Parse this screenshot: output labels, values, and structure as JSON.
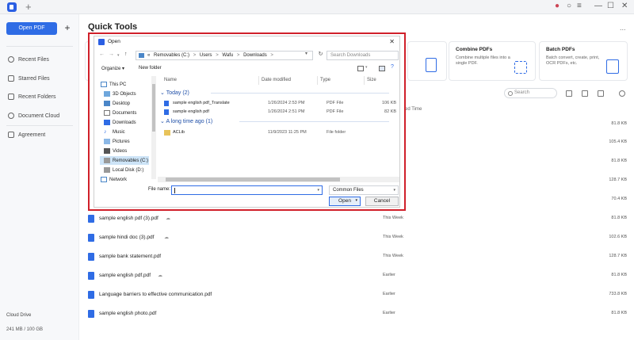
{
  "colors": {
    "accent": "#2f6ce5",
    "dialog_border": "#d0202a"
  },
  "sidebar": {
    "open_pdf": "Open PDF",
    "add": "+",
    "items": [
      {
        "label": "Recent Files",
        "icon": "clock-icon"
      },
      {
        "label": "Starred Files",
        "icon": "star-icon"
      },
      {
        "label": "Recent Folders",
        "icon": "folder-icon"
      },
      {
        "label": "Document Cloud",
        "icon": "cloud-icon"
      },
      {
        "label": "Agreement",
        "icon": "agreement-icon"
      }
    ],
    "cloud_drive": "Cloud Drive",
    "storage": "241 MB / 100 GB"
  },
  "main": {
    "quick_tools_title": "Quick Tools",
    "more": "...",
    "tools": [
      {
        "title": "Combine PDFs",
        "desc": "Combine multiple files into a single PDF."
      },
      {
        "title": "Batch PDFs",
        "desc": "Batch convert, create, print, OCR PDFs, etc."
      }
    ],
    "recent_head": "R",
    "search_placeholder": "Search",
    "col_name": "N",
    "col_time": "ed Time",
    "rows": [
      {
        "name": "",
        "time": "",
        "size": "81.8 KB"
      },
      {
        "name": "",
        "time": "",
        "size": "105.4 KB"
      },
      {
        "name": "",
        "time": "",
        "size": "81.8 KB"
      },
      {
        "name": "",
        "time": "",
        "size": "128.7 KB"
      },
      {
        "name": "",
        "time": "",
        "size": "70.4 KB"
      },
      {
        "name": "sample english pdf (3).pdf",
        "time": "This Week",
        "size": "81.8 KB"
      },
      {
        "name": "sample hindi doc (3).pdf",
        "time": "This Week",
        "size": "102.6 KB"
      },
      {
        "name": "sample bank statement.pdf",
        "time": "This Week",
        "size": "128.7 KB"
      },
      {
        "name": "sample english pdf.pdf",
        "time": "Earlier",
        "size": "81.8 KB"
      },
      {
        "name": "Language barriers to effective communication.pdf",
        "time": "Earlier",
        "size": "733.8 KB"
      },
      {
        "name": "sample english photo.pdf",
        "time": "Earlier",
        "size": "81.8 KB"
      }
    ]
  },
  "dialog": {
    "title": "Open",
    "close": "✕",
    "path": [
      "Removables (C:)",
      ">",
      "Users",
      ">",
      "Wafu",
      ">",
      "Downloads",
      ">"
    ],
    "path_prefix": "«",
    "search_placeholder": "Search Downloads",
    "organize": "Organize ▾",
    "new_folder": "New folder",
    "nav_items": [
      {
        "label": "This PC",
        "icon": "pc-icon"
      },
      {
        "label": "3D Objects",
        "icon": "cube-icon"
      },
      {
        "label": "Desktop",
        "icon": "desktop-icon"
      },
      {
        "label": "Documents",
        "icon": "documents-icon"
      },
      {
        "label": "Downloads",
        "icon": "download-icon"
      },
      {
        "label": "Music",
        "icon": "music-icon"
      },
      {
        "label": "Pictures",
        "icon": "pictures-icon"
      },
      {
        "label": "Videos",
        "icon": "videos-icon"
      },
      {
        "label": "Removables (C:)",
        "icon": "drive-icon"
      },
      {
        "label": "Local Disk (D:)",
        "icon": "drive-icon"
      },
      {
        "label": "Network",
        "icon": "network-icon"
      }
    ],
    "columns": {
      "name": "Name",
      "date": "Date modified",
      "type": "Type",
      "size": "Size"
    },
    "groups": [
      {
        "label": "Today (2)"
      },
      {
        "label": "A long time ago (1)"
      }
    ],
    "files": [
      {
        "name": "sample english pdf_Translate",
        "date": "1/26/2024 2:53 PM",
        "type": "PDF File",
        "size": "106 KB"
      },
      {
        "name": "sample english pdf",
        "date": "1/26/2024 2:51 PM",
        "type": "PDF File",
        "size": "82 KB"
      },
      {
        "name": "ACLib",
        "date": "11/9/2023 11:25 PM",
        "type": "File folder",
        "size": ""
      }
    ],
    "file_name_label": "File name:",
    "file_name_value": "",
    "file_type": "Common Files",
    "open": "Open",
    "cancel": "Cancel"
  }
}
